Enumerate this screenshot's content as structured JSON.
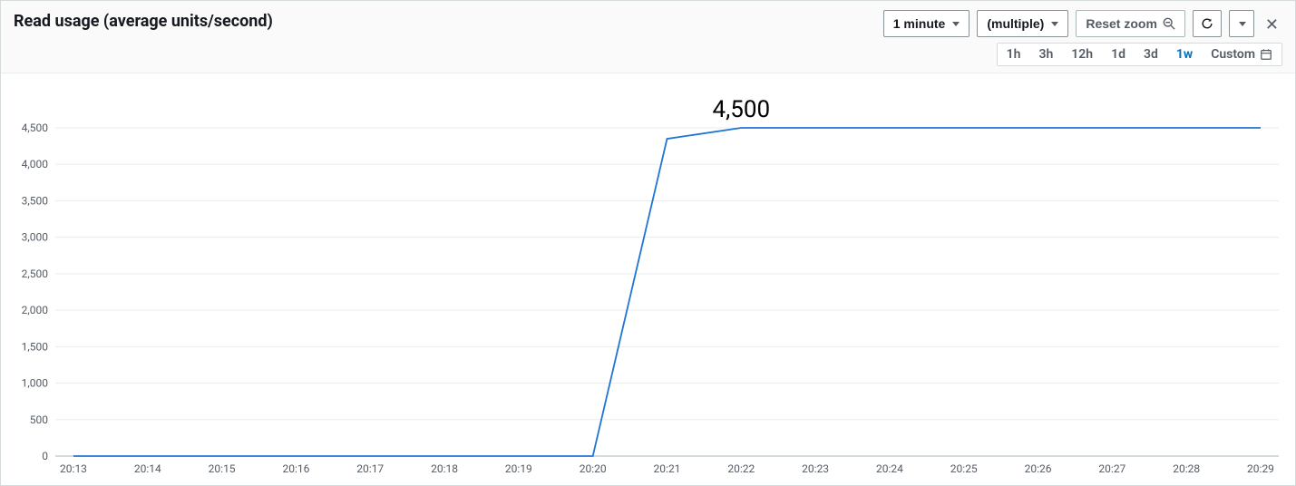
{
  "header": {
    "title": "Read usage (average units/second)",
    "period_label": "1 minute",
    "lines_label": "(multiple)",
    "reset_zoom_label": "Reset zoom"
  },
  "ranges": {
    "items": [
      "1h",
      "3h",
      "12h",
      "1d",
      "3d",
      "1w",
      "Custom"
    ],
    "active": "1w"
  },
  "chart_data": {
    "type": "line",
    "title": "Read usage (average units/second)",
    "xlabel": "",
    "ylabel": "",
    "ylim": [
      0,
      4500
    ],
    "y_ticks": [
      0,
      500,
      1000,
      1500,
      2000,
      2500,
      3000,
      3500,
      4000,
      4500
    ],
    "x_categories": [
      "20:13",
      "20:14",
      "20:15",
      "20:16",
      "20:17",
      "20:18",
      "20:19",
      "20:20",
      "20:21",
      "20:22",
      "20:23",
      "20:24",
      "20:25",
      "20:26",
      "20:27",
      "20:28",
      "20:29"
    ],
    "series": [
      {
        "name": "Read usage",
        "color": "#2074d5",
        "values": [
          0,
          0,
          0,
          0,
          0,
          0,
          0,
          0,
          4350,
          4500,
          4500,
          4500,
          4500,
          4500,
          4500,
          4500,
          4500
        ]
      }
    ],
    "annotations": [
      {
        "x": "20:22",
        "y": 4500,
        "text": "4,500",
        "dy": -12
      }
    ]
  }
}
